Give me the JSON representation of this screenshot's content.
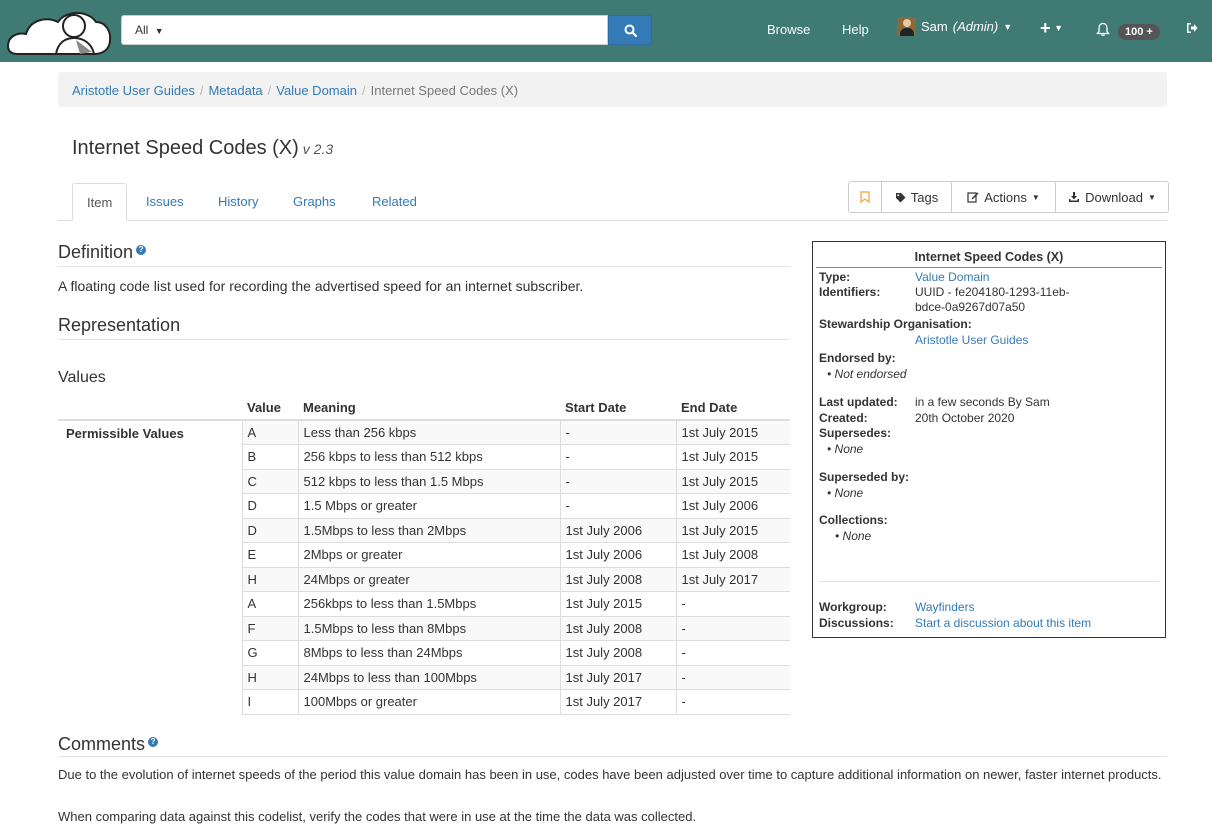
{
  "navbar": {
    "search_scope": "All",
    "search_placeholder": "",
    "browse": "Browse",
    "help": "Help",
    "user_name": "Sam",
    "user_role": "(Admin)",
    "notification_count": "100 +"
  },
  "breadcrumb": {
    "items": [
      "Aristotle User Guides",
      "Metadata",
      "Value Domain"
    ],
    "current": "Internet Speed Codes (X)"
  },
  "page": {
    "title": "Internet Speed Codes (X)",
    "version": "v 2.3"
  },
  "tabs": [
    "Item",
    "Issues",
    "History",
    "Graphs",
    "Related"
  ],
  "toolbar": {
    "tags": "Tags",
    "actions": "Actions",
    "download": "Download"
  },
  "definition": {
    "heading": "Definition",
    "text": "A floating code list used for recording the advertised speed for an internet subscriber."
  },
  "representation": {
    "heading": "Representation"
  },
  "values": {
    "heading": "Values",
    "columns": [
      "Value",
      "Meaning",
      "Start Date",
      "End Date"
    ],
    "row_label": "Permissible Values",
    "rows": [
      {
        "value": "A",
        "meaning": "Less than 256 kbps",
        "start": "-",
        "end": "1st July 2015"
      },
      {
        "value": "B",
        "meaning": "256 kbps to less than 512 kbps",
        "start": "-",
        "end": "1st July 2015"
      },
      {
        "value": "C",
        "meaning": "512 kbps to less than 1.5 Mbps",
        "start": "-",
        "end": "1st July 2015"
      },
      {
        "value": "D",
        "meaning": "1.5 Mbps or greater",
        "start": "-",
        "end": "1st July 2006"
      },
      {
        "value": "D",
        "meaning": "1.5Mbps to less than 2Mbps",
        "start": "1st July 2006",
        "end": "1st July 2015"
      },
      {
        "value": "E",
        "meaning": "2Mbps or greater",
        "start": "1st July 2006",
        "end": "1st July 2008"
      },
      {
        "value": "H",
        "meaning": "24Mbps or greater",
        "start": "1st July 2008",
        "end": "1st July 2017"
      },
      {
        "value": "A",
        "meaning": "256kbps to less than 1.5Mbps",
        "start": "1st July 2015",
        "end": "-"
      },
      {
        "value": "F",
        "meaning": "1.5Mbps to less than 8Mbps",
        "start": "1st July 2008",
        "end": "-"
      },
      {
        "value": "G",
        "meaning": "8Mbps to less than 24Mbps",
        "start": "1st July 2008",
        "end": "-"
      },
      {
        "value": "H",
        "meaning": "24Mbps to less than 100Mbps",
        "start": "1st July 2017",
        "end": "-"
      },
      {
        "value": "I",
        "meaning": "100Mbps or greater",
        "start": "1st July 2017",
        "end": "-"
      }
    ]
  },
  "infobox": {
    "title": "Internet Speed Codes (X)",
    "type_label": "Type:",
    "type_value": "Value Domain",
    "identifiers_label": "Identifiers:",
    "identifiers_line1": "UUID - fe204180-1293-11eb-",
    "identifiers_line2": "bdce-0a9267d07a50",
    "steward_label": "Stewardship Organisation:",
    "steward_value": "Aristotle User Guides",
    "endorsed_label": "Endorsed by:",
    "endorsed_value": "Not endorsed",
    "updated_label": "Last updated:",
    "updated_value": "in a few seconds By Sam",
    "created_label": "Created:",
    "created_value": "20th October 2020",
    "supersedes_label": "Supersedes:",
    "supersedes_value": "None",
    "superseded_label": "Superseded by:",
    "superseded_value": "None",
    "collections_label": "Collections:",
    "collections_value": "None",
    "workgroup_label": "Workgroup:",
    "workgroup_value": "Wayfinders",
    "discussions_label": "Discussions:",
    "discussions_value": "Start a discussion about this item"
  },
  "comments": {
    "heading": "Comments",
    "paragraph1": "Due to the evolution of internet speeds of the period this value domain has been in use, codes have been adjusted over time to capture additional information on newer, faster internet products.",
    "paragraph2": "When comparing data against this codelist, verify the codes that were in use at the time the data was collected."
  },
  "colors": {
    "navbar": "#3f7a75",
    "link": "#337ab7",
    "bookmark": "#f0ad4e"
  }
}
